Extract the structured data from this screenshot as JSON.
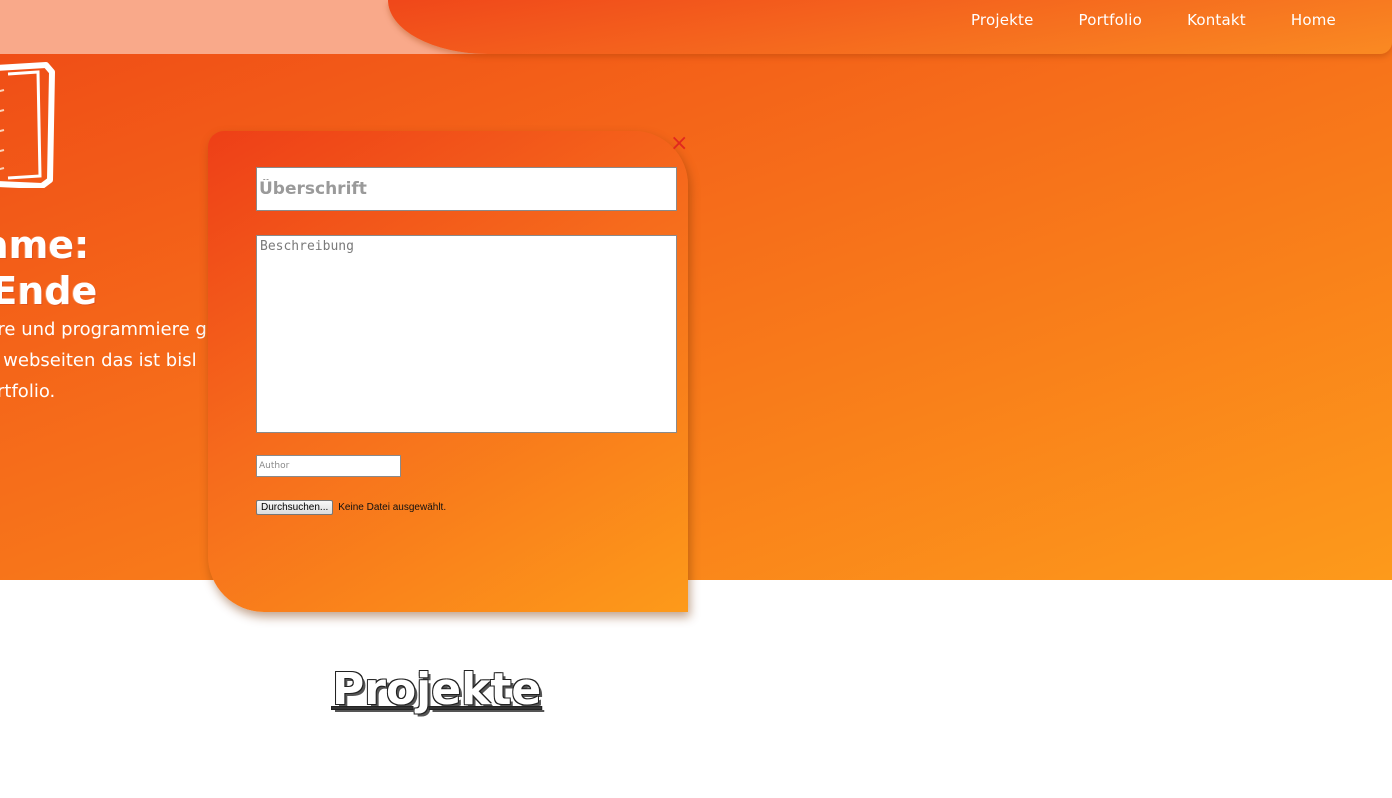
{
  "nav": {
    "items": [
      "Projekte",
      "Portfolio",
      "Kontakt",
      "Home"
    ]
  },
  "hero": {
    "heading_line1": "name:",
    "heading_line2": "z Ende",
    "paragraph": "hre und programmiere g\nd webseiten das ist bisl\nortfolio."
  },
  "modal": {
    "close_icon": "×",
    "title_placeholder": "Überschrift",
    "description_placeholder": "Beschreibung",
    "author_placeholder": "Author",
    "file_button_label": "Durchsuchen...",
    "file_status": "Keine Datei ausgewählt."
  },
  "section": {
    "heading": "Projekte"
  },
  "colors": {
    "accent": "#f66e1a",
    "close": "#e1281e",
    "pale_header": "#f9a98a"
  },
  "icons": {
    "close": "close-icon",
    "logo": "logo-sketch-icon"
  }
}
